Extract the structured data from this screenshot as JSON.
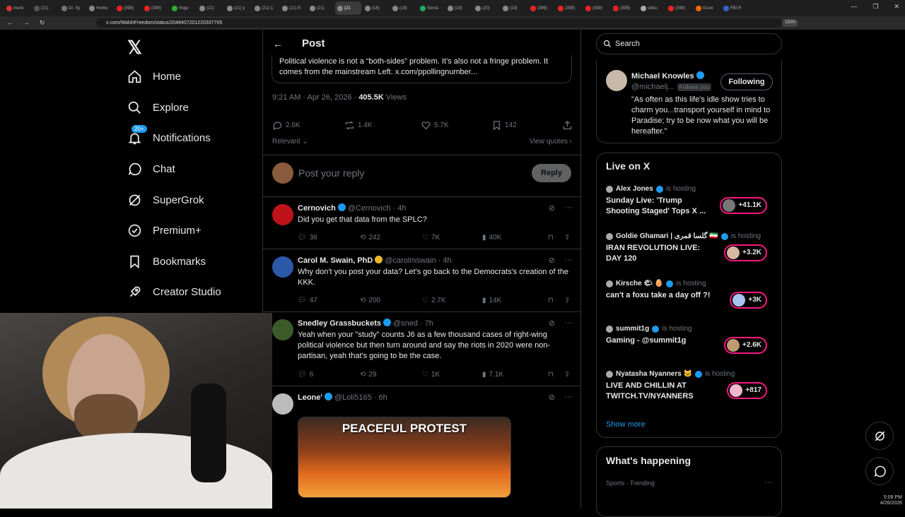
{
  "browser": {
    "tabs": [
      "munc",
      "(21)",
      "Dr. Sy",
      "Home",
      "(399)",
      "(399)",
      "Imgu",
      "(21)",
      "(21) y",
      "(21) C",
      "(21) E",
      "(21)",
      "(21",
      "(18)",
      "(18)",
      "Socra",
      "(19)",
      "(20)",
      "(19)",
      "(399)",
      "(399)",
      "(399)",
      "(399)",
      "ubisc",
      "(399)",
      "r/Live",
      "FBI R"
    ],
    "active_tab_index": 12,
    "url": "x.com/WalshFreedom/status/2048407201220337705",
    "zoom": "150%"
  },
  "nav": {
    "items": [
      {
        "label": "Home",
        "icon": "home-icon"
      },
      {
        "label": "Explore",
        "icon": "search-icon"
      },
      {
        "label": "Notifications",
        "icon": "bell-icon",
        "badge": "20+"
      },
      {
        "label": "Chat",
        "icon": "chat-icon"
      },
      {
        "label": "SuperGrok",
        "icon": "grok-icon"
      },
      {
        "label": "Premium+",
        "icon": "premium-icon"
      },
      {
        "label": "Bookmarks",
        "icon": "bookmark-icon"
      },
      {
        "label": "Creator Studio",
        "icon": "rocket-icon"
      }
    ]
  },
  "post": {
    "header_title": "Post",
    "quoted_text": "Political violence is not a “both-sides” problem. It’s also not a fringe problem. It comes from the mainstream Left. x.com/ppollingnumber...",
    "timestamp": "9:21 AM · Apr 26, 2026 ·",
    "views": "405.5K",
    "views_label": "Views",
    "replies": "2.6K",
    "reposts": "1.4K",
    "likes": "5.7K",
    "bookmarks": "142",
    "sort_label": "Relevant",
    "view_quotes": "View quotes",
    "reply_placeholder": "Post your reply",
    "reply_button": "Reply"
  },
  "replies": [
    {
      "name": "Cernovich",
      "handle": "@Cernovich · 4h",
      "text": "Did you get that data from the SPLC?",
      "replies": "36",
      "reposts": "242",
      "likes": "7K",
      "views": "40K",
      "verified": "blue",
      "avatar_color": "#c0121b"
    },
    {
      "name": "Carol M. Swain, PhD",
      "handle": "@carolmswain · 4h",
      "text": "Why don't you post your data? Let's go back to the Democrats's creation of the KKK.",
      "replies": "47",
      "reposts": "200",
      "likes": "2.7K",
      "views": "14K",
      "verified": "gold",
      "avatar_color": "#2c58a8"
    },
    {
      "name": "Snedley Grassbuckets",
      "handle": "@sned · 7h",
      "text": "Yeah when your \"study\" counts J6 as a few thousand cases of right-wing political violence but then turn around and say the riots in 2020 were non-partisan, yeah that's going to be the case.",
      "replies": "6",
      "reposts": "29",
      "likes": "1K",
      "views": "7.1K",
      "verified": "blue",
      "avatar_color": "#3a5a2a"
    },
    {
      "name": "Leone'",
      "handle": "@Loli5165 · 6h",
      "image_caption": "PEACEFUL PROTEST",
      "verified": "blue",
      "avatar_color": "#bbbbbb"
    }
  ],
  "sidebar": {
    "search_placeholder": "Search",
    "profile": {
      "name": "Michael Knowles",
      "handle": "@michaelj...",
      "follows_you": "Follows you",
      "button": "Following",
      "bio": "\"As often as this life's idle show tries to charm you...transport yourself in mind to Paradise; try to be now what you will be hereafter.\""
    },
    "live_title": "Live on X",
    "hosting_label": "is hosting",
    "hosts": [
      {
        "name": "Alex Jones",
        "title": "Sunday Live: 'Trump Shooting Staged' Tops X ...",
        "count": "+41.1K"
      },
      {
        "name": "Goldie Ghamari | گلسا قمری 🇮🇷",
        "title": "IRAN REVOLUTION LIVE: DAY 120",
        "count": "+3.2K"
      },
      {
        "name": "Kirsche 🌤 🥚",
        "title": "can't a foxu take a day off ?!",
        "count": "+3K"
      },
      {
        "name": "summit1g",
        "title": "Gaming - @summit1g",
        "count": "+2.6K"
      },
      {
        "name": "Nyatasha Nyanners 🐱",
        "title": "LIVE AND CHILLIN AT TWITCH.TV/NYANNERS",
        "count": "+817"
      }
    ],
    "show_more": "Show more",
    "happening_title": "What's happening",
    "happening_sub": "Sports · Trending"
  },
  "system": {
    "time": "5:09 PM",
    "date": "4/26/2026"
  }
}
